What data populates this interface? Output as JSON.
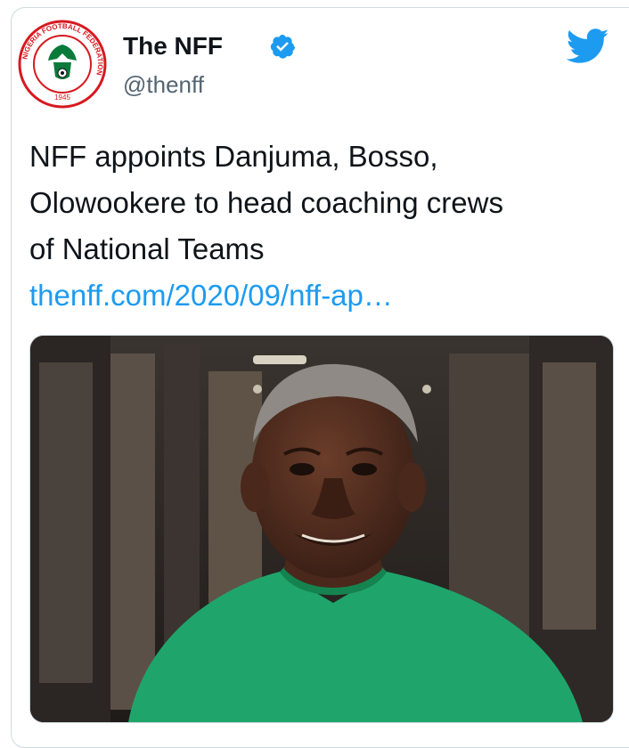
{
  "account": {
    "display_name": "The NFF",
    "handle": "@thenff",
    "verified": true,
    "avatar_icon": "nff-crest-logo",
    "avatar_ring_text": "NIGERIA FOOTBALL FEDERATION",
    "avatar_year": "1945"
  },
  "platform": {
    "icon": "twitter-bird-icon",
    "color": "#1d9bf0"
  },
  "tweet": {
    "text_lines": [
      "NFF appoints Danjuma, Bosso,",
      "Olowookere to head coaching crews",
      "of National Teams"
    ],
    "link": "thenff.com/2020/09/nff-ap…"
  },
  "media": {
    "alt_icon": "photo-of-man-in-green-shirt",
    "shirt_color": "#1fa56b"
  },
  "colors": {
    "text": "#0f1419",
    "secondary": "#536471",
    "link": "#1d9bf0",
    "border": "#cfd9de",
    "brand_red": "#d71920",
    "brand_green": "#0a7a3b"
  }
}
